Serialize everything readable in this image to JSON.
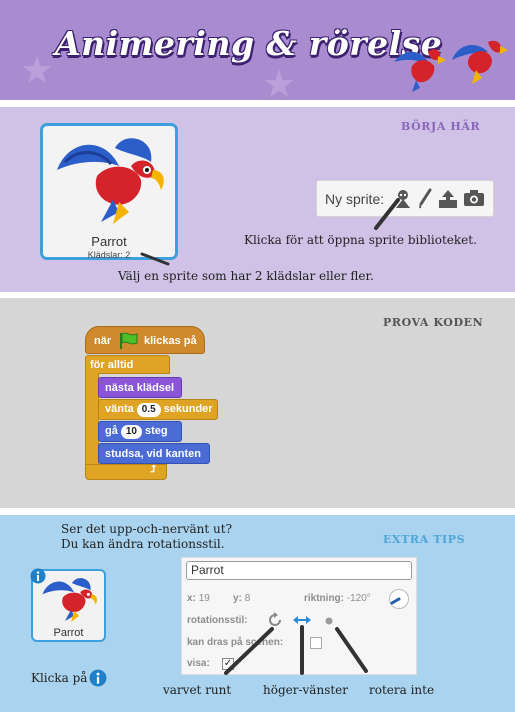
{
  "header": {
    "title": "Animering & rörelse"
  },
  "section1": {
    "title": "BÖRJA HÄR",
    "sprite": {
      "name": "Parrot",
      "costumes": "Klädslar: 2"
    },
    "toolbar_label": "Ny sprite:",
    "caption_library": "Klicka för att öppna sprite biblioteket.",
    "caption_choose": "Välj en sprite som har 2 klädslar eller fler."
  },
  "section2": {
    "title": "PROVA KODEN",
    "blocks": {
      "hat_pre": "när",
      "hat_post": "klickas på",
      "forever": "för alltid",
      "next_costume": "nästa klädsel",
      "wait_pre": "vänta",
      "wait_value": "0.5",
      "wait_post": "sekunder",
      "move_pre": "gå",
      "move_value": "10",
      "move_post": "steg",
      "bounce": "studsa, vid kanten"
    }
  },
  "section3": {
    "title": "EXTRA TIPS",
    "intro_line1": "Ser det upp-och-nervänt ut?",
    "intro_line2": "Du kan ändra rotationsstil.",
    "sprite_name": "Parrot",
    "click_label": "Klicka på",
    "info": {
      "name_value": "Parrot",
      "x_label": "x:",
      "x_value": "19",
      "y_label": "y:",
      "y_value": "8",
      "direction_label": "riktning:",
      "direction_value": "-120°",
      "rotation_label": "rotationsstil:",
      "draggable_label": "kan dras på scenen:",
      "show_label": "visa:"
    },
    "callouts": {
      "all_around": "varvet runt",
      "left_right": "höger-vänster",
      "dont_rotate": "rotera inte"
    }
  },
  "colors": {
    "header_bg": "#a98ccf",
    "section1_bg": "#cfc2e6",
    "section2_bg": "#d6d6d6",
    "section3_bg": "#a9d3ee",
    "accent_blue": "#3da0dc",
    "events": "#cf8a2e",
    "control": "#e0a424",
    "looks": "#8a55d7",
    "motion": "#4a6cd4"
  },
  "icons": [
    "parrot-sprite",
    "sprite-library-icon",
    "paint-brush-icon",
    "upload-icon",
    "camera-icon",
    "green-flag-icon",
    "info-icon",
    "rotate-all-around-icon",
    "left-right-icon",
    "dont-rotate-icon",
    "direction-dial-icon",
    "checkbox-icon"
  ]
}
